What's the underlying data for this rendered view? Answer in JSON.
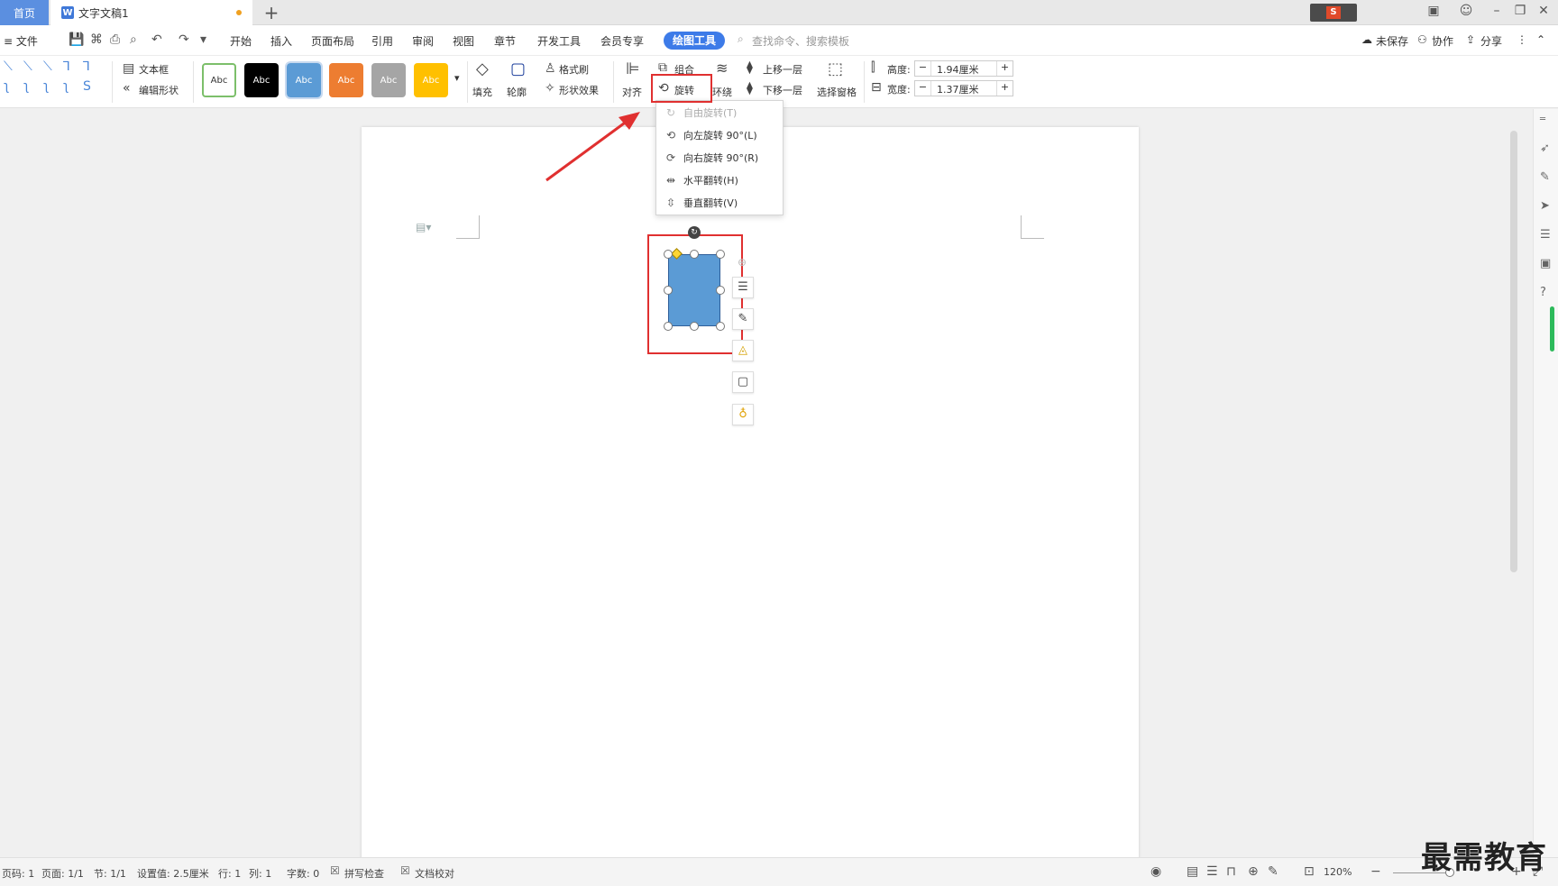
{
  "titlebar": {
    "home_tab": "首页",
    "doc_tab": "文字文稿1",
    "doc_icon": "W",
    "new_tab": "+",
    "minimize": "–",
    "restore": "❐",
    "close": "✕"
  },
  "menu": {
    "file": "≡ 文件",
    "items": [
      "开始",
      "插入",
      "页面布局",
      "引用",
      "审阅",
      "视图",
      "章节",
      "开发工具",
      "会员专享"
    ],
    "active": "绘图工具",
    "search": "查找命令、搜索模板",
    "unsaved": "未保存",
    "collab": "协作",
    "share": "分享"
  },
  "ribbon": {
    "textbox": "文本框",
    "edit_shape": "编辑形状",
    "styles": [
      "Abc",
      "Abc",
      "Abc",
      "Abc",
      "Abc",
      "Abc"
    ],
    "style_colors": [
      "#ffffff",
      "#000000",
      "#5b9bd5",
      "#ed7d31",
      "#a5a5a5",
      "#ffc000"
    ],
    "fill": "填充",
    "outline": "轮廓",
    "format_painter": "格式刷",
    "shape_effects": "形状效果",
    "align": "对齐",
    "group": "组合",
    "rotate": "旋转",
    "wrap": "环绕",
    "bring_forward": "上移一层",
    "send_backward": "下移一层",
    "selection_pane": "选择窗格",
    "height_label": "高度:",
    "height_value": "1.94厘米",
    "width_label": "宽度:",
    "width_value": "1.37厘米"
  },
  "rotate_menu": {
    "items": [
      {
        "label": "自由旋转(T)",
        "icon": "↻",
        "disabled": true
      },
      {
        "label": "向左旋转 90°(L)",
        "icon": "⟲",
        "disabled": false
      },
      {
        "label": "向右旋转 90°(R)",
        "icon": "⟳",
        "disabled": false
      },
      {
        "label": "水平翻转(H)",
        "icon": "⇹",
        "disabled": false
      },
      {
        "label": "垂直翻转(V)",
        "icon": "⇳",
        "disabled": false
      }
    ]
  },
  "status": {
    "page_num": "页码: 1",
    "pages": "页面: 1/1",
    "section": "节: 1/1",
    "setting": "设置值: 2.5厘米",
    "row": "行: 1",
    "col": "列: 1",
    "words": "字数: 0",
    "spellcheck": "拼写检查",
    "proofread": "文档校对",
    "zoom": "120%"
  },
  "watermark": "最需教育",
  "colors": {
    "accent": "#3d7be8",
    "shape_fill": "#5b9bd5",
    "highlight": "#e03030"
  }
}
